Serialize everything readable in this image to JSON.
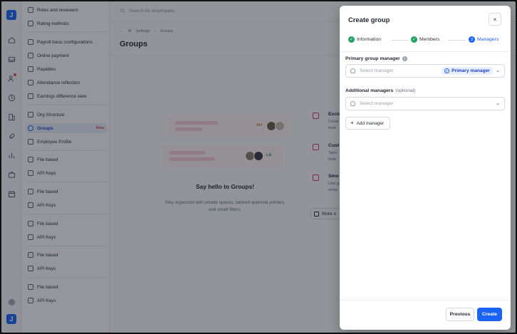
{
  "nav": {
    "items": [
      {
        "label": "Roles and reviewers"
      },
      {
        "label": "Rating methods"
      },
      {
        "label": "Payroll basic configurations"
      },
      {
        "label": "Online payment"
      },
      {
        "label": "Payables"
      },
      {
        "label": "Attendance reflection"
      },
      {
        "label": "Earnings difference view"
      },
      {
        "label": "Org Structure"
      },
      {
        "label": "Groups",
        "badge": "New"
      },
      {
        "label": "Employee Profile"
      },
      {
        "label": "File based"
      },
      {
        "label": "API Keys"
      },
      {
        "label": "File based"
      },
      {
        "label": "API Keys"
      },
      {
        "label": "File based"
      },
      {
        "label": "API Keys"
      },
      {
        "label": "File based"
      },
      {
        "label": "API Keys"
      },
      {
        "label": "File based"
      },
      {
        "label": "API Keys"
      }
    ]
  },
  "main": {
    "search_placeholder": "Search for employees",
    "breadcrumb": [
      "Settings",
      "Groups"
    ],
    "title": "Groups",
    "empty_title": "Say hello to Groups!",
    "empty_desc": "Stay organized with private spaces, tailored approval policies, and smart filters.",
    "avatar_tags": [
      "AH",
      "LA"
    ],
    "features": [
      {
        "title": "Exclu",
        "desc": "Creat\ntheir"
      },
      {
        "title": "Cust",
        "desc": "Tailo\ntheir"
      },
      {
        "title": "Smo",
        "desc": "Use g\nenha"
      }
    ],
    "more_label": "More o"
  },
  "modal": {
    "title": "Create group",
    "close_label": "×",
    "steps": [
      {
        "label": "Information",
        "status": "done"
      },
      {
        "label": "Members",
        "status": "done"
      },
      {
        "label": "Managers",
        "status": "current",
        "number": "3"
      }
    ],
    "primary_label": "Primary group manager",
    "primary_placeholder": "Select manager",
    "primary_badge": "Primary manager",
    "additional_label": "Additional managers",
    "additional_optional": "(optional)",
    "additional_placeholder": "Select manager",
    "add_manager_label": "Add manager",
    "previous_label": "Previous",
    "create_label": "Create"
  },
  "colors": {
    "accent": "#1b63f5",
    "success": "#22a060",
    "new_badge": "#e5484d"
  }
}
